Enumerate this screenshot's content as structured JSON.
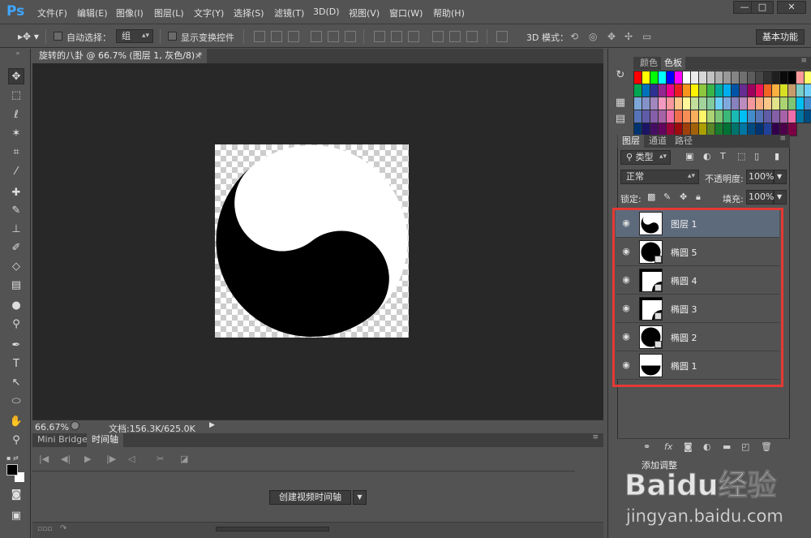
{
  "app": {
    "logo": "Ps"
  },
  "menu": [
    "文件(F)",
    "编辑(E)",
    "图像(I)",
    "图层(L)",
    "文字(Y)",
    "选择(S)",
    "滤镜(T)",
    "3D(D)",
    "视图(V)",
    "窗口(W)",
    "帮助(H)"
  ],
  "window_controls": {
    "minimize": "—",
    "maximize": "□",
    "close": "✕"
  },
  "options": {
    "auto_select_label": "自动选择：",
    "auto_select_value": "组",
    "show_transform_label": "显示变换控件",
    "mode_3d_label": "3D 模式：",
    "workspace": "基本功能"
  },
  "document": {
    "tab_title": "旋转的八卦 @ 66.7% (图层 1, 灰色/8) *",
    "tab_close": "×",
    "zoom": "66.67%",
    "doc_info": "文档:156.3K/625.0K"
  },
  "timeline": {
    "tabs": [
      "Mini Bridge",
      "时间轴"
    ],
    "create_button": "创建视频时间轴"
  },
  "swatches": {
    "tabs": [
      "颜色",
      "色板"
    ],
    "colors": [
      "#ff0000",
      "#ffff00",
      "#00ff00",
      "#00ffff",
      "#0000ff",
      "#ff00ff",
      "#ffffff",
      "#ebebeb",
      "#d6d6d6",
      "#c2c2c2",
      "#adadad",
      "#999999",
      "#858585",
      "#707070",
      "#5c5c5c",
      "#474747",
      "#333333",
      "#1f1f1f",
      "#0a0a0a",
      "#000000",
      "#ff9999",
      "#ffff66",
      "#00a651",
      "#0072bc",
      "#2e3192",
      "#92278f",
      "#ec008c",
      "#ed1c24",
      "#f7941d",
      "#fff200",
      "#8dc63f",
      "#39b54a",
      "#00a99d",
      "#00aeef",
      "#0054a6",
      "#662d91",
      "#9e005d",
      "#ed145b",
      "#f26522",
      "#fbb040",
      "#d7df23",
      "#c69c6d",
      "#7accc8",
      "#6dcff6",
      "#7da7d9",
      "#8393ca",
      "#a187be",
      "#f49ac2",
      "#f6989d",
      "#fdc68a",
      "#fff799",
      "#c4df9b",
      "#a3d39c",
      "#82ca9d",
      "#6ecff6",
      "#7fa9dc",
      "#8781bd",
      "#bd8cbf",
      "#f5989d",
      "#f9ad81",
      "#fdc689",
      "#e1e289",
      "#abd373",
      "#7dc473",
      "#00bff3",
      "#448ccb",
      "#5674b9",
      "#605ca8",
      "#855fa8",
      "#a763a8",
      "#f06eaa",
      "#f26c4f",
      "#f68e56",
      "#fbaf5d",
      "#fff568",
      "#acd373",
      "#7cc576",
      "#3bb878",
      "#1abbb4",
      "#00bff3",
      "#438ccb",
      "#5574b8",
      "#605ca8",
      "#8560a8",
      "#a863a8",
      "#f06ea9",
      "#0076a3",
      "#004b80",
      "#003471",
      "#1b1464",
      "#440e62",
      "#630460",
      "#9e0039",
      "#9e0b0f",
      "#a0410d",
      "#a36209",
      "#aba000",
      "#598527",
      "#197b30",
      "#007236",
      "#00746b",
      "#0076a3",
      "#004a80",
      "#003370",
      "#21409a",
      "#32004b",
      "#4b0049",
      "#7b0046"
    ]
  },
  "layers": {
    "tabs": [
      "图层",
      "通道",
      "路径"
    ],
    "filter_label": "类型",
    "blend_mode": "正常",
    "opacity_label": "不透明度:",
    "opacity_value": "100%",
    "lock_label": "锁定:",
    "fill_label": "填充:",
    "fill_value": "100%",
    "items": [
      {
        "name": "图层 1",
        "selected": true,
        "thumb": "yinyang"
      },
      {
        "name": "椭圆 5",
        "selected": false,
        "thumb": "black-circle"
      },
      {
        "name": "椭圆 4",
        "selected": false,
        "thumb": "white"
      },
      {
        "name": "椭圆 3",
        "selected": false,
        "thumb": "white"
      },
      {
        "name": "椭圆 2",
        "selected": false,
        "thumb": "black-circle"
      },
      {
        "name": "椭圆 1",
        "selected": false,
        "thumb": "half"
      }
    ]
  },
  "adjustments": {
    "title": "添加调整"
  },
  "watermark": {
    "brand": "Baidu经验",
    "url": "jingyan.baidu.com"
  }
}
